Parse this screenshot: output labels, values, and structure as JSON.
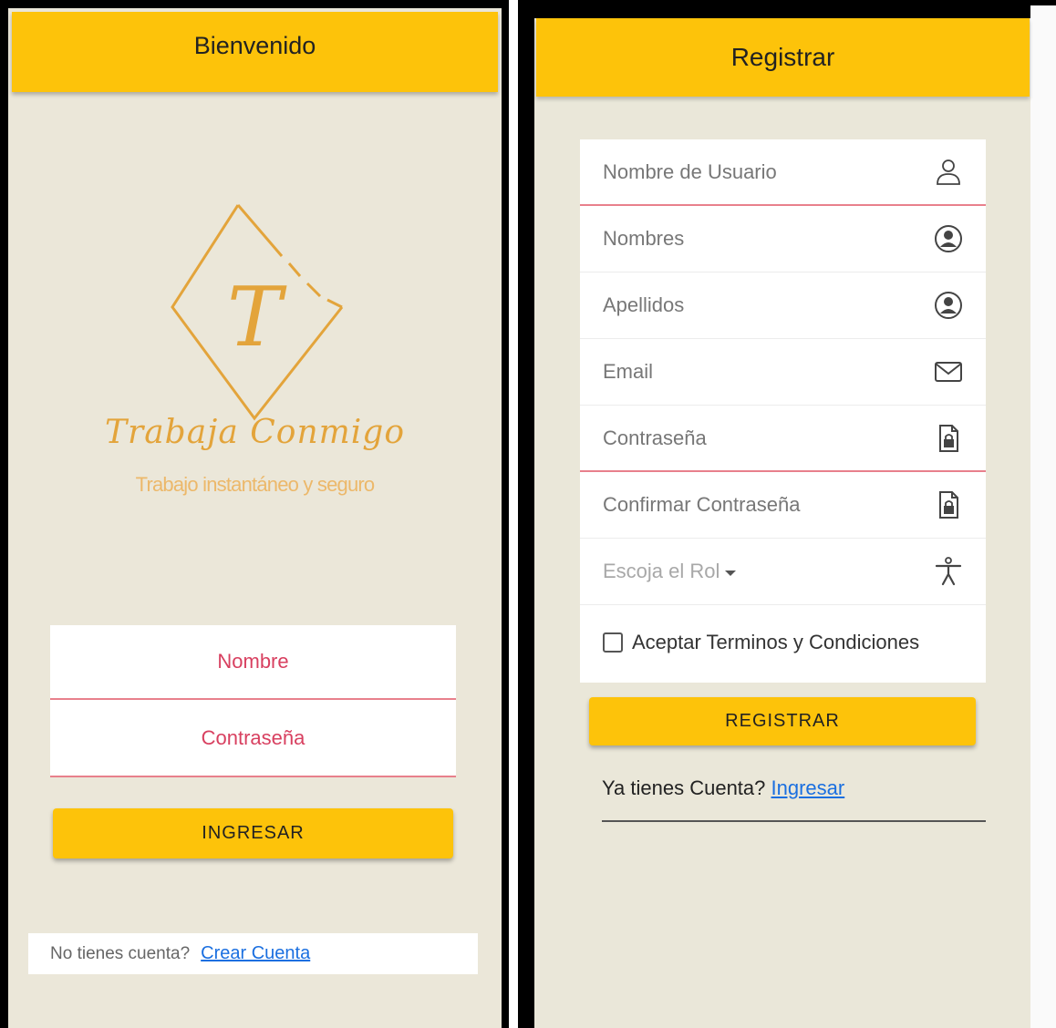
{
  "login": {
    "header_title": "Bienvenido",
    "brand_name": "Trabaja Conmigo",
    "tagline": "Trabajo instantáneo y seguro",
    "logo_letter": "T",
    "username_placeholder": "Nombre",
    "password_placeholder": "Contraseña",
    "submit_label": "INGRESAR",
    "no_account_text": "No tienes cuenta?",
    "create_account_link": "Crear Cuenta"
  },
  "register": {
    "header_title": "Registrar",
    "fields": [
      {
        "label": "Nombre de Usuario",
        "icon": "user-outline-icon"
      },
      {
        "label": "Nombres",
        "icon": "account-circle-icon"
      },
      {
        "label": "Apellidos",
        "icon": "account-circle-icon"
      },
      {
        "label": "Email",
        "icon": "mail-icon"
      },
      {
        "label": "Contraseña",
        "icon": "lock-file-icon"
      },
      {
        "label": "Confirmar Contraseña",
        "icon": "lock-file-icon"
      }
    ],
    "role_select": {
      "placeholder": "Escoja el Rol",
      "icon": "accessibility-icon"
    },
    "terms_label": "Aceptar Terminos y Condiciones",
    "submit_label": "REGISTRAR",
    "have_account_text": "Ya tienes Cuenta?",
    "login_link": "Ingresar"
  },
  "colors": {
    "accent": "#fdc30a",
    "background": "#ebe7d9",
    "field_underline": "#e8808c",
    "login_placeholder": "#d84060",
    "link": "#1a6fe0",
    "logo": "#e3a43b"
  }
}
